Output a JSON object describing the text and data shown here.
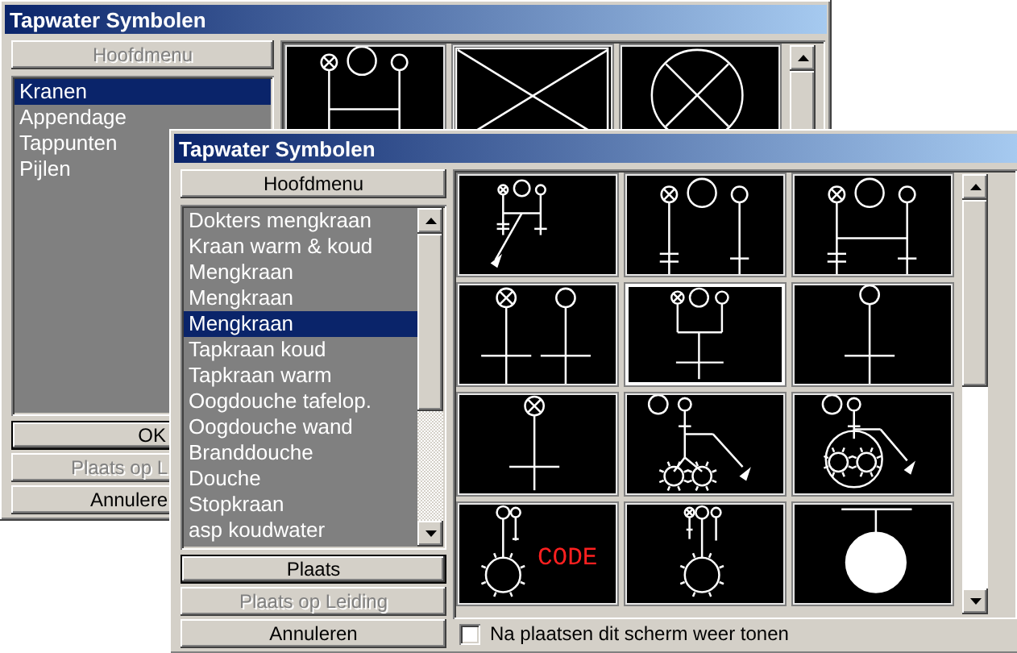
{
  "windows": [
    {
      "title": "Tapwater Symbolen",
      "menu_button": {
        "label": "Hoofdmenu",
        "disabled": true
      },
      "list": {
        "items": [
          {
            "label": "Kranen",
            "selected": true
          },
          {
            "label": "Appendage",
            "selected": false
          },
          {
            "label": "Tappunten",
            "selected": false
          },
          {
            "label": "Pijlen",
            "selected": false
          }
        ]
      },
      "symbols": [
        {
          "kind": "valves-bridge",
          "selected": false
        },
        {
          "kind": "crossed-box",
          "selected": false
        },
        {
          "kind": "crossed-circle",
          "selected": false
        }
      ],
      "buttons": [
        {
          "label": "OK",
          "disabled": false,
          "default": true
        },
        {
          "label": "Plaats op L",
          "disabled": true,
          "default": false
        },
        {
          "label": "Annulere",
          "disabled": false,
          "default": false
        }
      ]
    },
    {
      "title": "Tapwater Symbolen",
      "menu_button": {
        "label": "Hoofdmenu",
        "disabled": false
      },
      "list": {
        "items": [
          {
            "label": "Dokters mengkraan",
            "selected": false
          },
          {
            "label": "Kraan warm & koud",
            "selected": false
          },
          {
            "label": "Mengkraan",
            "selected": false
          },
          {
            "label": "Mengkraan",
            "selected": false
          },
          {
            "label": "Mengkraan",
            "selected": true
          },
          {
            "label": "Tapkraan koud",
            "selected": false
          },
          {
            "label": "Tapkraan warm",
            "selected": false
          },
          {
            "label": "Oogdouche tafelop.",
            "selected": false
          },
          {
            "label": "Oogdouche wand",
            "selected": false
          },
          {
            "label": "Branddouche",
            "selected": false
          },
          {
            "label": "Douche",
            "selected": false
          },
          {
            "label": "Stopkraan",
            "selected": false
          },
          {
            "label": "asp koudwater",
            "selected": false
          }
        ]
      },
      "symbols": [
        {
          "kind": "mixer-diagonal",
          "selected": false
        },
        {
          "kind": "three-valves",
          "selected": false
        },
        {
          "kind": "three-valves-bridge",
          "selected": false
        },
        {
          "kind": "two-valves",
          "selected": false
        },
        {
          "kind": "mixer",
          "selected": true
        },
        {
          "kind": "single-valve",
          "selected": false
        },
        {
          "kind": "single-crossed",
          "selected": false
        },
        {
          "kind": "shower-pair",
          "selected": false
        },
        {
          "kind": "shower-ring",
          "selected": false
        },
        {
          "kind": "code-shower",
          "selected": false,
          "code_label": "CODE"
        },
        {
          "kind": "valve-shower",
          "selected": false
        },
        {
          "kind": "filled-circle",
          "selected": false
        }
      ],
      "buttons": [
        {
          "label": "Plaats",
          "disabled": false,
          "default": true
        },
        {
          "label": "Plaats op Leiding",
          "disabled": true,
          "default": false
        },
        {
          "label": "Annuleren",
          "disabled": false,
          "default": false
        }
      ],
      "checkbox": {
        "label": "Na plaatsen dit scherm weer tonen",
        "checked": false
      }
    }
  ]
}
